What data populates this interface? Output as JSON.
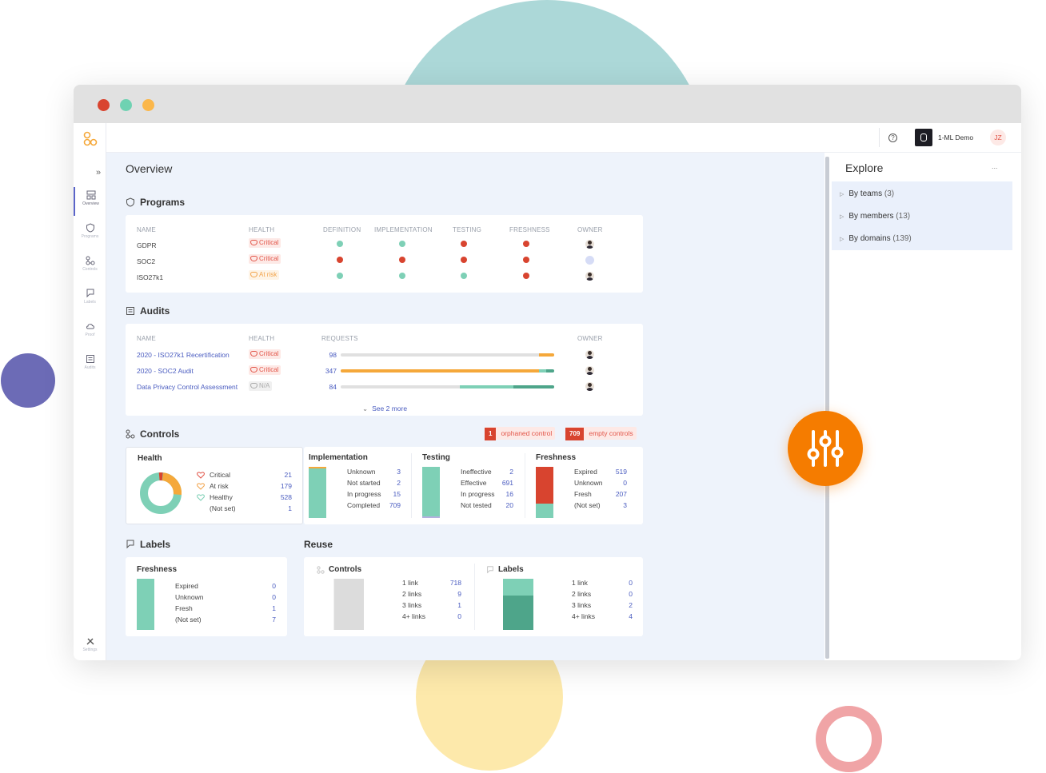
{
  "window": {
    "controls": [
      "close",
      "minimize",
      "zoom"
    ]
  },
  "sidebar": {
    "expand_icon": "double-chevron-right-icon",
    "items": [
      {
        "label": "Overview",
        "icon": "grid-icon",
        "active": true
      },
      {
        "label": "Programs",
        "icon": "shield-icon"
      },
      {
        "label": "Controls",
        "icon": "nodes-icon"
      },
      {
        "label": "Labels",
        "icon": "bookmark-icon"
      },
      {
        "label": "Proof",
        "icon": "cloud-icon"
      },
      {
        "label": "Audits",
        "icon": "clipboard-icon"
      }
    ],
    "settings_label": "Settings"
  },
  "topbar": {
    "help_icon": "question-icon",
    "workspace": "1-ML Demo",
    "user_initials": "JZ"
  },
  "page": {
    "title": "Overview"
  },
  "programs": {
    "title": "Programs",
    "headers": [
      "NAME",
      "HEALTH",
      "DEFINITION",
      "IMPLEMENTATION",
      "TESTING",
      "FRESHNESS",
      "OWNER"
    ],
    "rows": [
      {
        "name": "GDPR",
        "health": "Critical",
        "health_type": "critical",
        "statuses": [
          "#7ed0b6",
          "#7ed0b6",
          "#d8442f",
          "#d8442f"
        ]
      },
      {
        "name": "SOC2",
        "health": "Critical",
        "health_type": "critical",
        "statuses": [
          "#d8442f",
          "#d8442f",
          "#d8442f",
          "#d8442f"
        ]
      },
      {
        "name": "ISO27k1",
        "health": "At risk",
        "health_type": "warn",
        "statuses": [
          "#7ed0b6",
          "#7ed0b6",
          "#7ed0b6",
          "#d8442f"
        ]
      }
    ]
  },
  "audits": {
    "title": "Audits",
    "headers": [
      "NAME",
      "HEALTH",
      "REQUESTS",
      "OWNER"
    ],
    "rows": [
      {
        "name": "2020 - ISO27k1 Recertification",
        "health": "Critical",
        "requests": "98"
      },
      {
        "name": "2020 - SOC2 Audit",
        "health": "Critical",
        "requests": "347"
      },
      {
        "name": "Data Privacy Control Assessment",
        "health": "N/A",
        "requests": "84"
      }
    ],
    "see_more": "See 2 more"
  },
  "controls": {
    "title": "Controls",
    "orphaned": {
      "count": "1",
      "label": "orphaned control"
    },
    "empty": {
      "count": "709",
      "label": "empty controls"
    },
    "health": {
      "title": "Health",
      "items": [
        {
          "label": "Critical",
          "value": "21"
        },
        {
          "label": "At risk",
          "value": "179"
        },
        {
          "label": "Healthy",
          "value": "528"
        },
        {
          "label": "(Not set)",
          "value": "1"
        }
      ]
    },
    "implementation": {
      "title": "Implementation",
      "items": [
        {
          "label": "Unknown",
          "value": "3",
          "color": "#f5a83a"
        },
        {
          "label": "Not started",
          "value": "2",
          "color": "#dcdcdc"
        },
        {
          "label": "In progress",
          "value": "15",
          "color": "#b4b0e0"
        },
        {
          "label": "Completed",
          "value": "709",
          "color": "#7ed0b6"
        }
      ]
    },
    "testing": {
      "title": "Testing",
      "items": [
        {
          "label": "Ineffective",
          "value": "2",
          "color": "#d8442f"
        },
        {
          "label": "Effective",
          "value": "691",
          "color": "#7ed0b6"
        },
        {
          "label": "In progress",
          "value": "16",
          "color": "#b4b0e0"
        },
        {
          "label": "Not tested",
          "value": "20",
          "color": "#dcdcdc"
        }
      ]
    },
    "freshness": {
      "title": "Freshness",
      "items": [
        {
          "label": "Expired",
          "value": "519",
          "color": "#d8442f"
        },
        {
          "label": "Unknown",
          "value": "0",
          "color": "#f5a83a"
        },
        {
          "label": "Fresh",
          "value": "207",
          "color": "#7ed0b6"
        },
        {
          "label": "(Not set)",
          "value": "3",
          "color": "transparent"
        }
      ]
    }
  },
  "labels": {
    "title": "Labels",
    "freshness": {
      "title": "Freshness",
      "items": [
        {
          "label": "Expired",
          "value": "0",
          "color": "#d8442f"
        },
        {
          "label": "Unknown",
          "value": "0",
          "color": "#f5a83a"
        },
        {
          "label": "Fresh",
          "value": "1",
          "color": "#7ed0b6"
        },
        {
          "label": "(Not set)",
          "value": "7",
          "color": "transparent"
        }
      ]
    }
  },
  "reuse": {
    "title": "Reuse",
    "controls": {
      "title": "Controls",
      "items": [
        {
          "label": "1 link",
          "value": "718",
          "color": "#dcdcdc"
        },
        {
          "label": "2 links",
          "value": "9",
          "color": "#eaf6f1"
        },
        {
          "label": "3 links",
          "value": "1",
          "color": "#7ed0b6"
        },
        {
          "label": "4+ links",
          "value": "0",
          "color": "#4ea58a"
        }
      ]
    },
    "labels": {
      "title": "Labels",
      "items": [
        {
          "label": "1 link",
          "value": "0",
          "color": "#dcdcdc"
        },
        {
          "label": "2 links",
          "value": "0",
          "color": "#eaf6f1"
        },
        {
          "label": "3 links",
          "value": "2",
          "color": "#7ed0b6"
        },
        {
          "label": "4+ links",
          "value": "4",
          "color": "#4ea58a"
        }
      ]
    }
  },
  "explore": {
    "title": "Explore",
    "more": "...",
    "items": [
      {
        "label": "By teams",
        "count": "(3)"
      },
      {
        "label": "By members",
        "count": "(13)"
      },
      {
        "label": "By domains",
        "count": "(139)"
      }
    ]
  },
  "fab": {
    "icon": "sliders-icon",
    "color": "#f57c00"
  }
}
